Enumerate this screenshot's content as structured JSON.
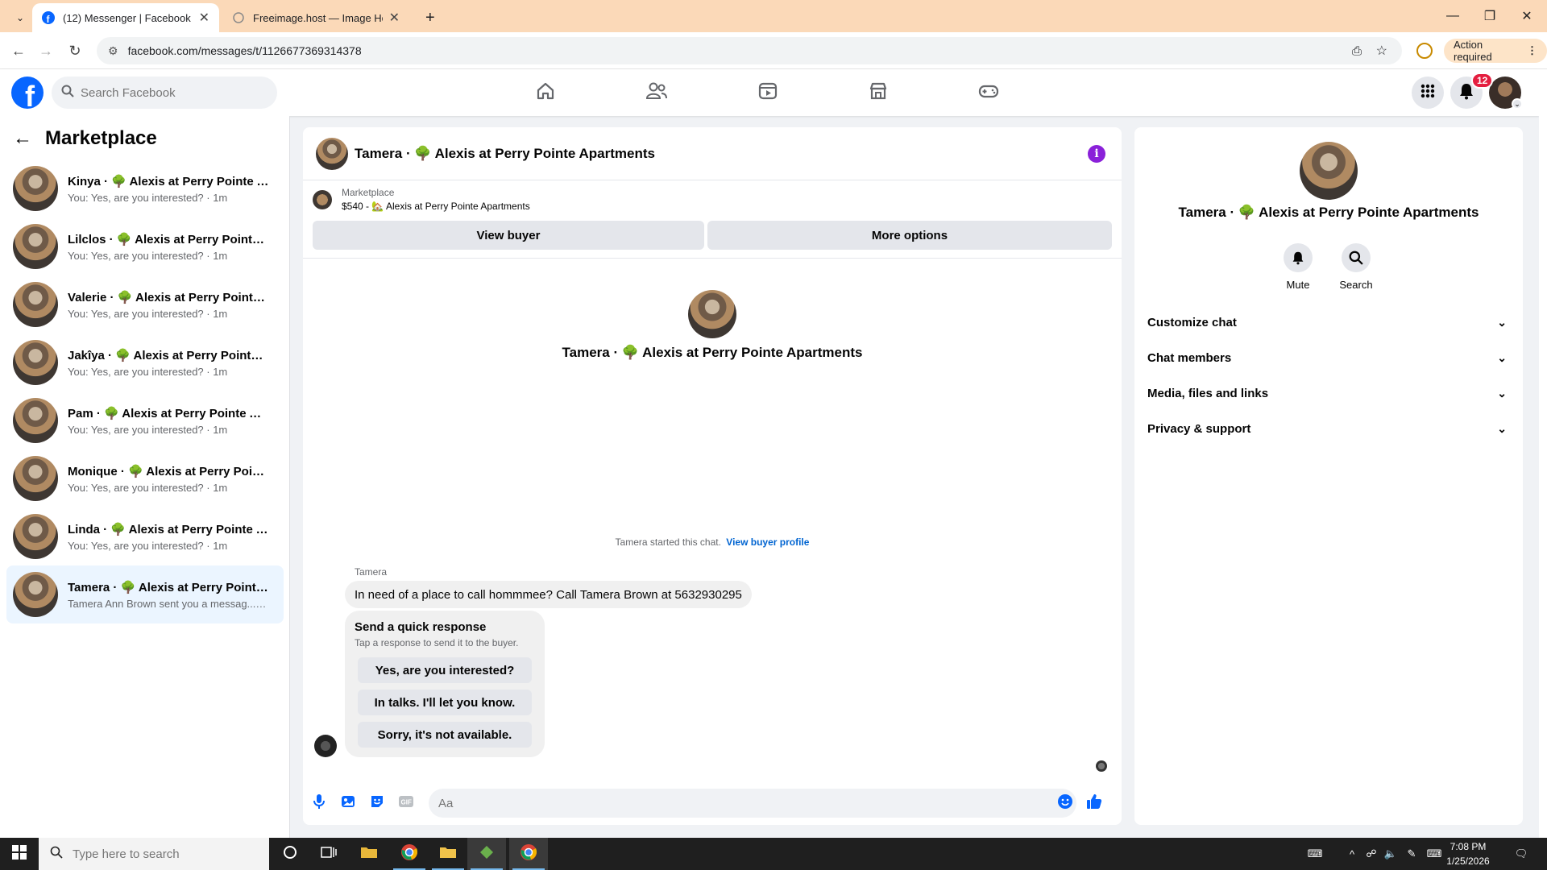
{
  "browser": {
    "tabs": [
      {
        "title": "(12) Messenger | Facebook",
        "active": true
      },
      {
        "title": "Freeimage.host — Image Hostin",
        "active": false
      }
    ],
    "url": "facebook.com/messages/t/1126677369314378",
    "action_required": "Action required"
  },
  "header": {
    "search_placeholder": "Search Facebook",
    "notification_count": "12"
  },
  "sidebar": {
    "title": "Marketplace",
    "conversations": [
      {
        "name": "Kinya · 🌳 Alexis at Perry Pointe A...",
        "preview": "You: Yes, are you interested? · 1m"
      },
      {
        "name": "Lilclos · 🌳 Alexis at Perry Pointe A...",
        "preview": "You: Yes, are you interested? · 1m"
      },
      {
        "name": "Valerie · 🌳 Alexis at Perry Pointe ...",
        "preview": "You: Yes, are you interested? · 1m"
      },
      {
        "name": "Jakîya · 🌳 Alexis at Perry Pointe A...",
        "preview": "You: Yes, are you interested? · 1m"
      },
      {
        "name": "Pam · 🌳 Alexis at Perry Pointe Ap...",
        "preview": "You: Yes, are you interested? · 1m"
      },
      {
        "name": "Monique · 🌳 Alexis at Perry Point...",
        "preview": "You: Yes, are you interested? · 1m"
      },
      {
        "name": "Linda · 🌳 Alexis at Perry Pointe A...",
        "preview": "You: Yes, are you interested? · 1m"
      },
      {
        "name": "Tamera · 🌳 Alexis at Perry Pointe ...",
        "preview": "Tamera Ann Brown sent you a messag... · 2h"
      }
    ]
  },
  "chat": {
    "title": "Tamera · 🌳 Alexis at Perry Pointe Apartments",
    "listing_label": "Marketplace",
    "listing_detail": "$540 - 🏡 Alexis at Perry Pointe Apartments",
    "view_buyer": "View buyer",
    "more_options": "More options",
    "intro_name": "Tamera · 🌳 Alexis at Perry Pointe Apartments",
    "started_text": "Tamera started this chat.",
    "view_buyer_profile": "View buyer profile",
    "sender": "Tamera",
    "message": "In need of a place to call hommmee? Call Tamera Brown at 5632930295",
    "quick_title": "Send a quick response",
    "quick_subtitle": "Tap a response to send it to the buyer.",
    "quick_responses": [
      "Yes, are you interested?",
      "In talks. I'll let you know.",
      "Sorry, it's not available."
    ],
    "input_placeholder": "Aa"
  },
  "info_panel": {
    "name": "Tamera · 🌳 Alexis at Perry Pointe Apartments",
    "mute": "Mute",
    "search": "Search",
    "sections": [
      "Customize chat",
      "Chat members",
      "Media, files and links",
      "Privacy & support"
    ]
  },
  "taskbar": {
    "search_placeholder": "Type here to search",
    "time": "7:08 PM",
    "date": "1/25/2026"
  },
  "colors": {
    "fb_blue": "#0866ff",
    "tab_bar": "#fbd9b8",
    "selected_conv": "#ebf5ff",
    "info_icon": "#8a21d9",
    "badge": "#e41e3f"
  }
}
